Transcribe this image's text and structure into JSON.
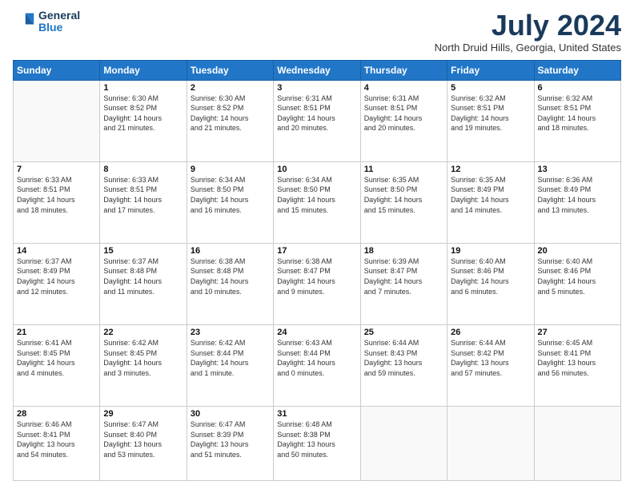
{
  "logo": {
    "line1": "General",
    "line2": "Blue"
  },
  "title": "July 2024",
  "location": "North Druid Hills, Georgia, United States",
  "days_of_week": [
    "Sunday",
    "Monday",
    "Tuesday",
    "Wednesday",
    "Thursday",
    "Friday",
    "Saturday"
  ],
  "weeks": [
    [
      {
        "day": "",
        "info": ""
      },
      {
        "day": "1",
        "info": "Sunrise: 6:30 AM\nSunset: 8:52 PM\nDaylight: 14 hours\nand 21 minutes."
      },
      {
        "day": "2",
        "info": "Sunrise: 6:30 AM\nSunset: 8:52 PM\nDaylight: 14 hours\nand 21 minutes."
      },
      {
        "day": "3",
        "info": "Sunrise: 6:31 AM\nSunset: 8:51 PM\nDaylight: 14 hours\nand 20 minutes."
      },
      {
        "day": "4",
        "info": "Sunrise: 6:31 AM\nSunset: 8:51 PM\nDaylight: 14 hours\nand 20 minutes."
      },
      {
        "day": "5",
        "info": "Sunrise: 6:32 AM\nSunset: 8:51 PM\nDaylight: 14 hours\nand 19 minutes."
      },
      {
        "day": "6",
        "info": "Sunrise: 6:32 AM\nSunset: 8:51 PM\nDaylight: 14 hours\nand 18 minutes."
      }
    ],
    [
      {
        "day": "7",
        "info": "Sunrise: 6:33 AM\nSunset: 8:51 PM\nDaylight: 14 hours\nand 18 minutes."
      },
      {
        "day": "8",
        "info": "Sunrise: 6:33 AM\nSunset: 8:51 PM\nDaylight: 14 hours\nand 17 minutes."
      },
      {
        "day": "9",
        "info": "Sunrise: 6:34 AM\nSunset: 8:50 PM\nDaylight: 14 hours\nand 16 minutes."
      },
      {
        "day": "10",
        "info": "Sunrise: 6:34 AM\nSunset: 8:50 PM\nDaylight: 14 hours\nand 15 minutes."
      },
      {
        "day": "11",
        "info": "Sunrise: 6:35 AM\nSunset: 8:50 PM\nDaylight: 14 hours\nand 15 minutes."
      },
      {
        "day": "12",
        "info": "Sunrise: 6:35 AM\nSunset: 8:49 PM\nDaylight: 14 hours\nand 14 minutes."
      },
      {
        "day": "13",
        "info": "Sunrise: 6:36 AM\nSunset: 8:49 PM\nDaylight: 14 hours\nand 13 minutes."
      }
    ],
    [
      {
        "day": "14",
        "info": "Sunrise: 6:37 AM\nSunset: 8:49 PM\nDaylight: 14 hours\nand 12 minutes."
      },
      {
        "day": "15",
        "info": "Sunrise: 6:37 AM\nSunset: 8:48 PM\nDaylight: 14 hours\nand 11 minutes."
      },
      {
        "day": "16",
        "info": "Sunrise: 6:38 AM\nSunset: 8:48 PM\nDaylight: 14 hours\nand 10 minutes."
      },
      {
        "day": "17",
        "info": "Sunrise: 6:38 AM\nSunset: 8:47 PM\nDaylight: 14 hours\nand 9 minutes."
      },
      {
        "day": "18",
        "info": "Sunrise: 6:39 AM\nSunset: 8:47 PM\nDaylight: 14 hours\nand 7 minutes."
      },
      {
        "day": "19",
        "info": "Sunrise: 6:40 AM\nSunset: 8:46 PM\nDaylight: 14 hours\nand 6 minutes."
      },
      {
        "day": "20",
        "info": "Sunrise: 6:40 AM\nSunset: 8:46 PM\nDaylight: 14 hours\nand 5 minutes."
      }
    ],
    [
      {
        "day": "21",
        "info": "Sunrise: 6:41 AM\nSunset: 8:45 PM\nDaylight: 14 hours\nand 4 minutes."
      },
      {
        "day": "22",
        "info": "Sunrise: 6:42 AM\nSunset: 8:45 PM\nDaylight: 14 hours\nand 3 minutes."
      },
      {
        "day": "23",
        "info": "Sunrise: 6:42 AM\nSunset: 8:44 PM\nDaylight: 14 hours\nand 1 minute."
      },
      {
        "day": "24",
        "info": "Sunrise: 6:43 AM\nSunset: 8:44 PM\nDaylight: 14 hours\nand 0 minutes."
      },
      {
        "day": "25",
        "info": "Sunrise: 6:44 AM\nSunset: 8:43 PM\nDaylight: 13 hours\nand 59 minutes."
      },
      {
        "day": "26",
        "info": "Sunrise: 6:44 AM\nSunset: 8:42 PM\nDaylight: 13 hours\nand 57 minutes."
      },
      {
        "day": "27",
        "info": "Sunrise: 6:45 AM\nSunset: 8:41 PM\nDaylight: 13 hours\nand 56 minutes."
      }
    ],
    [
      {
        "day": "28",
        "info": "Sunrise: 6:46 AM\nSunset: 8:41 PM\nDaylight: 13 hours\nand 54 minutes."
      },
      {
        "day": "29",
        "info": "Sunrise: 6:47 AM\nSunset: 8:40 PM\nDaylight: 13 hours\nand 53 minutes."
      },
      {
        "day": "30",
        "info": "Sunrise: 6:47 AM\nSunset: 8:39 PM\nDaylight: 13 hours\nand 51 minutes."
      },
      {
        "day": "31",
        "info": "Sunrise: 6:48 AM\nSunset: 8:38 PM\nDaylight: 13 hours\nand 50 minutes."
      },
      {
        "day": "",
        "info": ""
      },
      {
        "day": "",
        "info": ""
      },
      {
        "day": "",
        "info": ""
      }
    ]
  ]
}
